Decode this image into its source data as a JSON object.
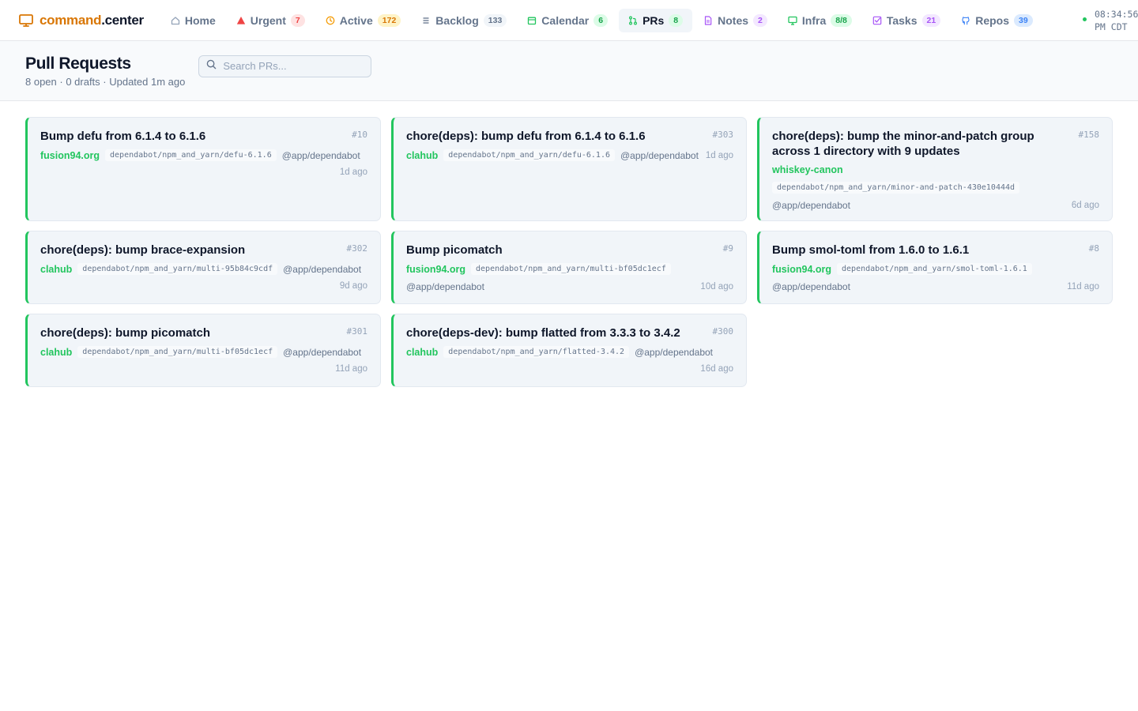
{
  "app": {
    "brand_a": "command",
    "brand_b": ".center",
    "brand_color": "#d97706"
  },
  "nav": [
    {
      "label": "Home",
      "icon": "home-icon",
      "badge": ""
    },
    {
      "label": "Urgent",
      "icon": "warning-triangle-icon",
      "badge": "7",
      "badge_bg": "#fee2e2",
      "badge_fg": "#ef4444",
      "icon_color": "#ef4444"
    },
    {
      "label": "Active",
      "icon": "clock-icon",
      "badge": "172",
      "badge_bg": "#fef3c7",
      "badge_fg": "#d97706",
      "icon_color": "#f59e0b"
    },
    {
      "label": "Backlog",
      "icon": "list-icon",
      "badge": "133",
      "badge_bg": "#f1f5f9",
      "badge_fg": "#64748b",
      "icon_color": "#64748b"
    },
    {
      "label": "Calendar",
      "icon": "calendar-icon",
      "badge": "6",
      "badge_bg": "#dcfce7",
      "badge_fg": "#16a34a",
      "icon_color": "#22c55e"
    },
    {
      "label": "PRs",
      "icon": "pull-request-icon",
      "badge": "8",
      "badge_bg": "#dcfce7",
      "badge_fg": "#16a34a",
      "icon_color": "#22c55e",
      "active": true
    },
    {
      "label": "Notes",
      "icon": "document-icon",
      "badge": "2",
      "badge_bg": "#f3e8ff",
      "badge_fg": "#a855f7",
      "icon_color": "#a855f7"
    },
    {
      "label": "Infra",
      "icon": "monitor-icon",
      "badge": "8/8",
      "badge_bg": "#dcfce7",
      "badge_fg": "#16a34a",
      "icon_color": "#22c55e"
    },
    {
      "label": "Tasks",
      "icon": "checkbox-icon",
      "badge": "21",
      "badge_bg": "#f3e8ff",
      "badge_fg": "#a855f7",
      "icon_color": "#a855f7"
    },
    {
      "label": "Repos",
      "icon": "github-icon",
      "badge": "39",
      "badge_bg": "#dbeafe",
      "badge_fg": "#3b82f6",
      "icon_color": "#3b82f6"
    }
  ],
  "clock": {
    "line1": "08:34:56",
    "line2": "PM CDT"
  },
  "header": {
    "title": "Pull Requests",
    "subtitle": "8 open · 0 drafts · Updated 1m ago",
    "search_placeholder": "Search PRs..."
  },
  "prs": [
    {
      "title": "Bump defu from 6.1.4 to 6.1.6",
      "number": "#10",
      "repo": "fusion94.org",
      "branch": "dependabot/npm_and_yarn/defu-6.1.6",
      "author": "@app/dependabot",
      "age": "1d ago"
    },
    {
      "title": "chore(deps): bump defu from 6.1.4 to 6.1.6",
      "number": "#303",
      "repo": "clahub",
      "branch": "dependabot/npm_and_yarn/defu-6.1.6",
      "author": "@app/dependabot",
      "age": "1d ago"
    },
    {
      "title": "chore(deps): bump the minor-and-patch group across 1 directory with 9 updates",
      "number": "#158",
      "repo": "whiskey-canon",
      "branch": "dependabot/npm_and_yarn/minor-and-patch-430e10444d",
      "author": "@app/dependabot",
      "age": "6d ago"
    },
    {
      "title": "chore(deps): bump brace-expansion",
      "number": "#302",
      "repo": "clahub",
      "branch": "dependabot/npm_and_yarn/multi-95b84c9cdf",
      "author": "@app/dependabot",
      "age": "9d ago"
    },
    {
      "title": "Bump picomatch",
      "number": "#9",
      "repo": "fusion94.org",
      "branch": "dependabot/npm_and_yarn/multi-bf05dc1ecf",
      "author": "@app/dependabot",
      "age": "10d ago"
    },
    {
      "title": "Bump smol-toml from 1.6.0 to 1.6.1",
      "number": "#8",
      "repo": "fusion94.org",
      "branch": "dependabot/npm_and_yarn/smol-toml-1.6.1",
      "author": "@app/dependabot",
      "age": "11d ago"
    },
    {
      "title": "chore(deps): bump picomatch",
      "number": "#301",
      "repo": "clahub",
      "branch": "dependabot/npm_and_yarn/multi-bf05dc1ecf",
      "author": "@app/dependabot",
      "age": "11d ago"
    },
    {
      "title": "chore(deps-dev): bump flatted from 3.3.3 to 3.4.2",
      "number": "#300",
      "repo": "clahub",
      "branch": "dependabot/npm_and_yarn/flatted-3.4.2",
      "author": "@app/dependabot",
      "age": "16d ago"
    }
  ],
  "colors": {
    "pr_open": "#22c55e"
  }
}
